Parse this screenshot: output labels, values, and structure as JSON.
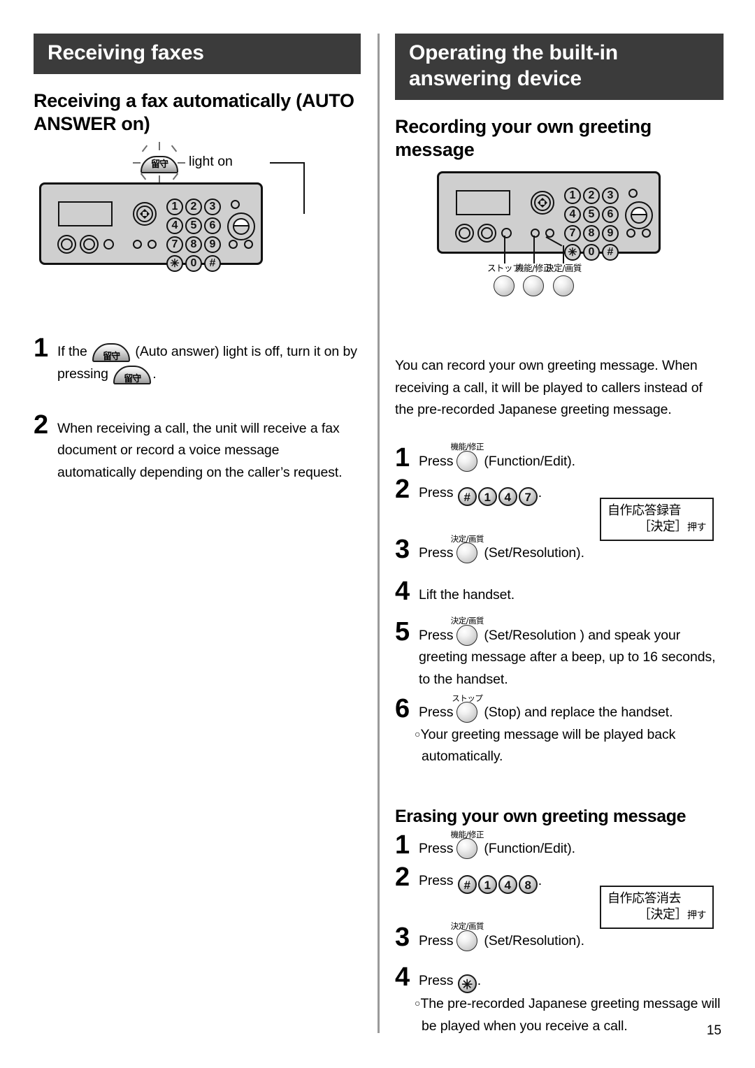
{
  "page_number": "15",
  "left_column": {
    "banner_title": "Receiving faxes",
    "section_heading": "Receiving a fax automatically (AUTO ANSWER on)",
    "illustration": {
      "indicator_label_jp": "留守",
      "callout_text": "light on",
      "keypad": [
        "1",
        "2",
        "3",
        "4",
        "5",
        "6",
        "7",
        "8",
        "9",
        "✳",
        "0",
        "#"
      ]
    },
    "steps": [
      {
        "number": "1",
        "text_before": "If the",
        "button_jp": "留守",
        "text_middle": "(Auto answer) light is off, turn it on by pressing",
        "button_jp_2": "留守",
        "text_after": "."
      },
      {
        "number": "2",
        "text": "When receiving a call, the unit will receive a fax document or record a voice message automatically depending on the caller’s request."
      }
    ]
  },
  "right_column": {
    "banner_title": "Operating the built-in answering device",
    "section_heading": "Recording your own greeting message",
    "illustration": {
      "keypad": [
        "1",
        "2",
        "3",
        "4",
        "5",
        "6",
        "7",
        "8",
        "9",
        "✳",
        "0",
        "#"
      ],
      "callouts": [
        {
          "caption_jp": "ストップ",
          "name": "stop"
        },
        {
          "caption_jp": "機能/修正",
          "name": "function-edit"
        },
        {
          "caption_jp": "決定/画質",
          "name": "set-resolution"
        }
      ]
    },
    "intro_paragraph": "You can record your own greeting message. When receiving a call, it will be played to callers instead of the pre-recorded Japanese greeting message.",
    "record_steps": [
      {
        "number": "1",
        "press": "Press",
        "button_cap_jp": "機能/修正",
        "label": "(Function/Edit)."
      },
      {
        "number": "2",
        "press": "Press",
        "keys": [
          "#",
          "1",
          "4",
          "7"
        ],
        "period": "."
      },
      {
        "number": "3",
        "press": "Press",
        "button_cap_jp": "決定/画質",
        "label": "(Set/Resolution)."
      },
      {
        "number": "4",
        "text": "Lift the handset."
      },
      {
        "number": "5",
        "press": "Press",
        "button_cap_jp": "決定/画質",
        "label": "(Set/Resolution ) and speak your greeting message after a beep, up to 16 seconds, to the handset."
      },
      {
        "number": "6",
        "press": "Press",
        "button_cap_jp": "ストップ",
        "label": "(Stop) and replace the handset.",
        "note": "Your greeting message will be played back automatically."
      }
    ],
    "record_lcd": {
      "line1": "自作応答録音",
      "line2_bracket": "［決定］",
      "line2_suffix": "押す"
    },
    "erase_heading": "Erasing your own greeting message",
    "erase_steps": [
      {
        "number": "1",
        "press": "Press",
        "button_cap_jp": "機能/修正",
        "label": "(Function/Edit)."
      },
      {
        "number": "2",
        "press": "Press",
        "keys": [
          "#",
          "1",
          "4",
          "8"
        ],
        "period": "."
      },
      {
        "number": "3",
        "press": "Press",
        "button_cap_jp": "決定/画質",
        "label": "(Set/Resolution)."
      },
      {
        "number": "4",
        "press": "Press",
        "keys": [
          "✳"
        ],
        "period": ".",
        "note": "The pre-recorded Japanese greeting message will be played when you receive a call."
      }
    ],
    "erase_lcd": {
      "line1": "自作応答消去",
      "line2_bracket": "［決定］",
      "line2_suffix": "押す"
    }
  },
  "colors": {
    "banner_bg": "#3b3b3b",
    "panel_fill": "#cfcfcf",
    "ink": "#000000"
  }
}
